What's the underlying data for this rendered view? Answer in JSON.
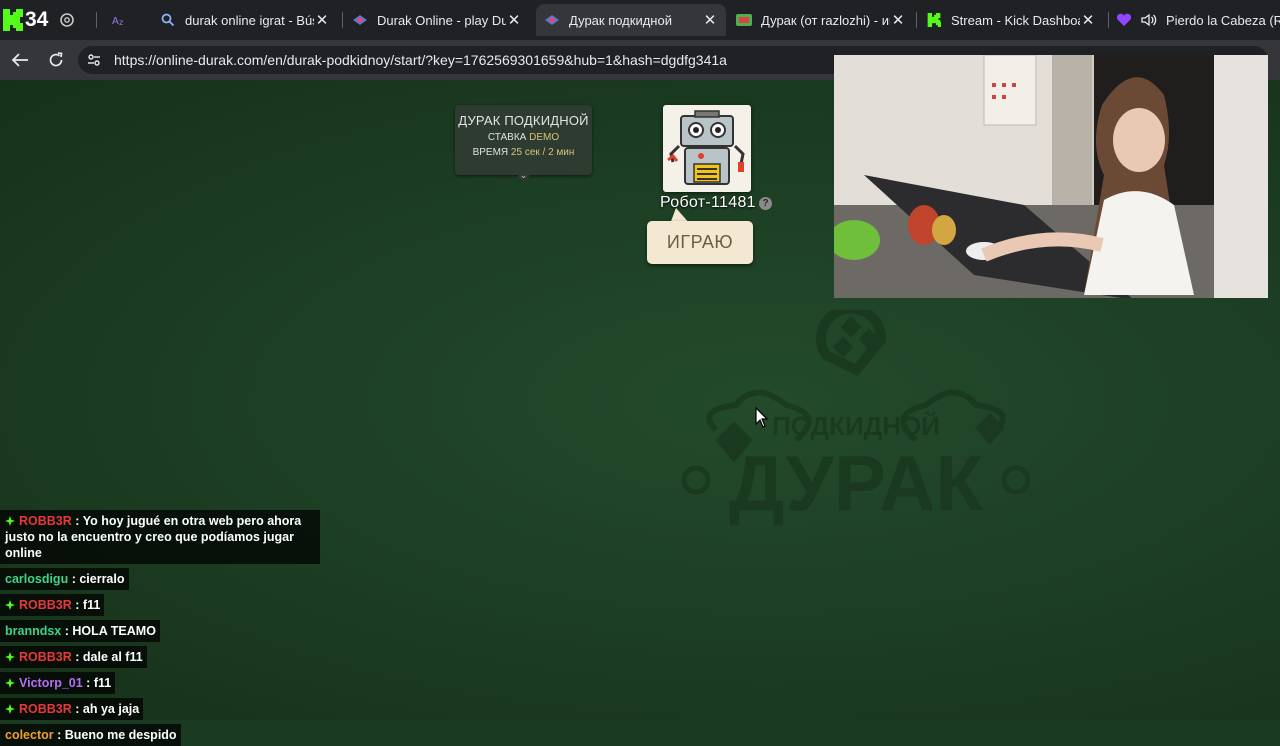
{
  "browser": {
    "counter": "34",
    "tabs": [
      {
        "title": "durak online igrat - Búsque",
        "favicon": "search-icon",
        "active": false
      },
      {
        "title": "Durak Online - play Durak",
        "favicon": "durak-favicon",
        "active": false
      },
      {
        "title": "Дурак подкидной",
        "favicon": "durak-favicon",
        "active": true
      },
      {
        "title": "Дурак (от razlozhi) - игра",
        "favicon": "razlozhi-favicon",
        "active": false
      },
      {
        "title": "Stream - Kick Dashboard",
        "favicon": "kick-favicon",
        "active": false
      },
      {
        "title": "Pierdo la Cabeza (Re",
        "favicon": "heart-favicon",
        "active": false
      }
    ],
    "close_glyph": "✕",
    "url": "https://online-durak.com/en/durak-podkidnoy/start/?key=1762569301659&hub=1&hash=dgdfg341a"
  },
  "game": {
    "info": {
      "name": "ДУРАК ПОДКИДНОЙ",
      "stake_label": "СТАВКА",
      "stake_value": "DEMO",
      "time_label": "ВРЕМЯ",
      "time_value": "25 сек / 2 мин"
    },
    "opponent": {
      "name": "Робот-11481",
      "help": "?",
      "status": "ИГРАЮ"
    },
    "watermark": {
      "small": "ПОДКИДНОЙ",
      "big": "ДУРАК"
    }
  },
  "chat": [
    {
      "user": "ROBB3R",
      "text": "Yo hoy jugué en otra web pero ahora justo no la encuentro y creo que podíamos jugar online",
      "color": "#e8383d",
      "badge": true
    },
    {
      "user": "carlosdigu",
      "text": "cierralo",
      "color": "#3fd38a",
      "badge": false
    },
    {
      "user": "ROBB3R",
      "text": "f11",
      "color": "#e8383d",
      "badge": true
    },
    {
      "user": "branndsx",
      "text": "HOLA TEAMO",
      "color": "#3fd38a",
      "badge": false
    },
    {
      "user": "ROBB3R",
      "text": "dale al f11",
      "color": "#e8383d",
      "badge": true
    },
    {
      "user": "Victorp_01",
      "text": "f11",
      "color": "#b66df5",
      "badge": true
    },
    {
      "user": "ROBB3R",
      "text": "ah ya jaja",
      "color": "#e8383d",
      "badge": true
    },
    {
      "user": "colector",
      "text": "Bueno me despido",
      "color": "#f0a030",
      "badge": false
    }
  ],
  "colors": {
    "felt": "#1c3d23",
    "kick_green": "#53fc18",
    "bubble": "#f3e9d2"
  }
}
